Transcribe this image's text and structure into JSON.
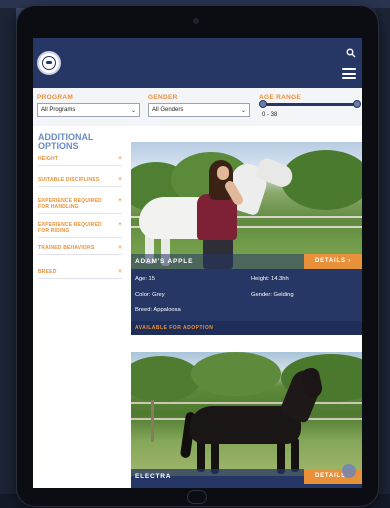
{
  "filters": {
    "program": {
      "label": "PROGRAM",
      "value": "All Programs"
    },
    "gender": {
      "label": "GENDER",
      "value": "All Genders"
    },
    "age_range": {
      "label": "AGE RANGE",
      "value_text": "0 - 38",
      "min": 0,
      "max": 38
    }
  },
  "sidebar": {
    "title": "ADDITIONAL OPTIONS",
    "items": [
      {
        "label": "HEIGHT"
      },
      {
        "label": "SUITABLE DISCIPLINES"
      },
      {
        "label": "EXPERIENCE REQUIRED FOR HANDLING"
      },
      {
        "label": "EXPERIENCE REQUIRED FOR RIDING"
      },
      {
        "label": "TRAINED BEHAVIORS"
      },
      {
        "label": "BREED"
      }
    ]
  },
  "cards": [
    {
      "name": "ADAM'S APPLE",
      "details_label": "DETAILS ›",
      "age": "Age: 15",
      "height": "Height: 14.3hh",
      "color": "Color: Grey",
      "gender": "Gender: Gelding",
      "breed": "Breed: Appaloosa",
      "status": "AVAILABLE FOR ADOPTION"
    },
    {
      "name": "ELECTRA",
      "details_label": "DETAILS ›"
    }
  ],
  "colors": {
    "brand_navy": "#263766",
    "accent_orange": "#e8913a"
  },
  "icons": [
    "logo-seal-icon",
    "search-icon",
    "hamburger-menu-icon",
    "plus-icon",
    "chevron-down-icon"
  ]
}
